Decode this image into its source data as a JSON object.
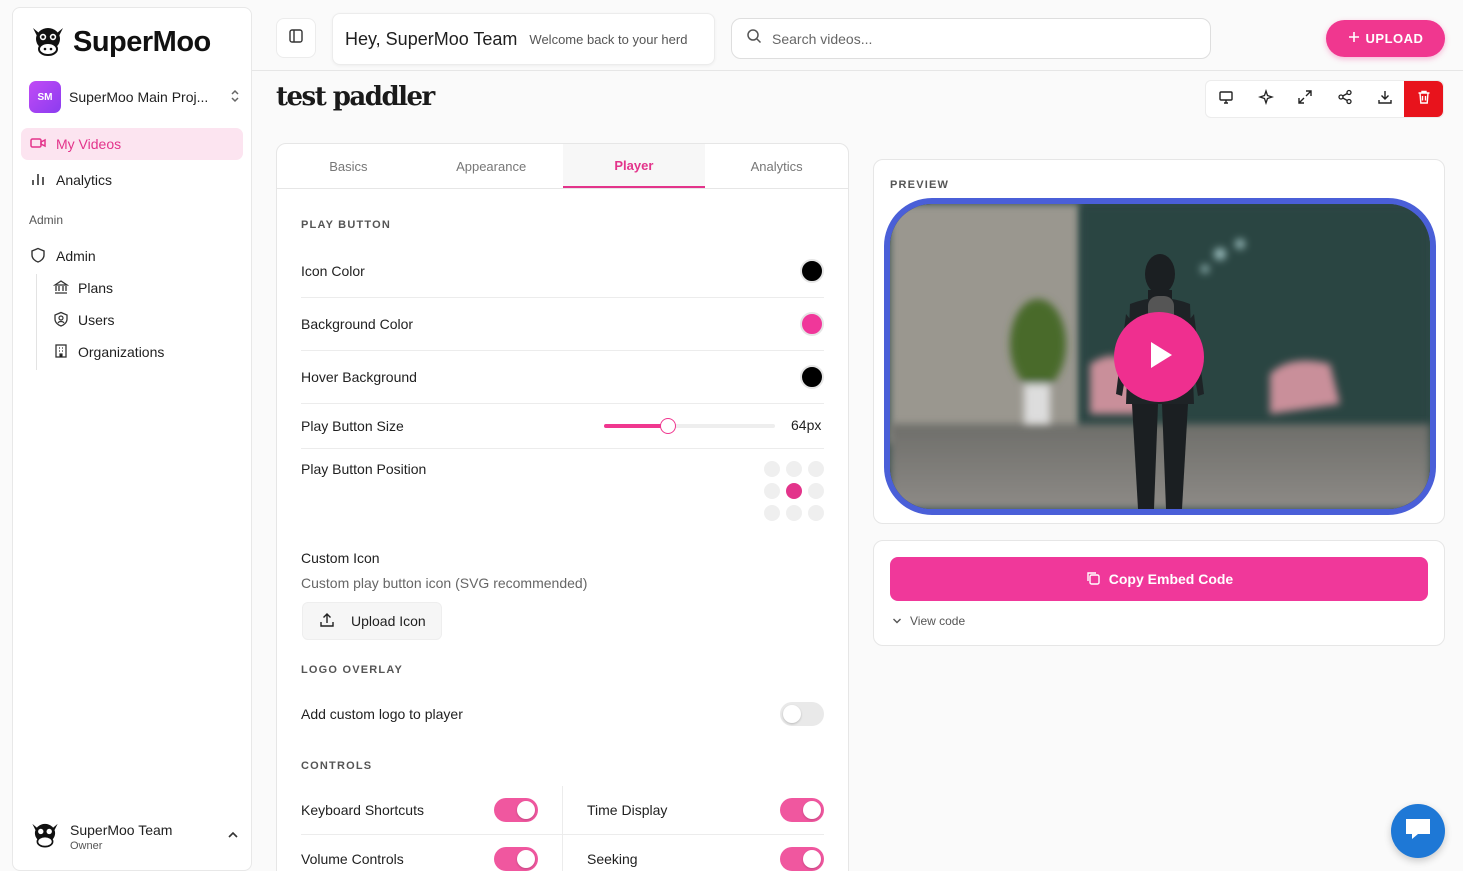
{
  "brand": {
    "name": "SuperMoo"
  },
  "project": {
    "initials": "SM",
    "name": "SuperMoo Main Proj..."
  },
  "nav": {
    "my_videos": "My Videos",
    "analytics": "Analytics",
    "admin_section": "Admin",
    "admin": "Admin",
    "plans": "Plans",
    "users": "Users",
    "organizations": "Organizations"
  },
  "user": {
    "name": "SuperMoo Team",
    "role": "Owner"
  },
  "header": {
    "greeting": "Hey, SuperMoo Team",
    "subtitle": "Welcome back to your herd",
    "search_placeholder": "Search videos...",
    "upload_label": "UPLOAD"
  },
  "page": {
    "title": "test paddler"
  },
  "toolbar": {
    "icons": [
      "monitor-icon",
      "sparkles-icon",
      "expand-icon",
      "share-icon",
      "download-icon",
      "trash-icon"
    ]
  },
  "tabs": [
    "Basics",
    "Appearance",
    "Player",
    "Analytics"
  ],
  "active_tab": "Player",
  "play_button": {
    "section_title": "PLAY BUTTON",
    "icon_color_label": "Icon Color",
    "icon_color": "#000000",
    "background_color_label": "Background Color",
    "background_color": "#f0379a",
    "hover_background_label": "Hover Background",
    "hover_background": "#000000",
    "size_label": "Play Button Size",
    "size_value": "64px",
    "size_fraction": 0.375,
    "position_label": "Play Button Position",
    "position_selected": "center",
    "custom_icon_label": "Custom Icon",
    "custom_icon_hint": "Custom play button icon (SVG recommended)",
    "upload_icon_label": "Upload Icon"
  },
  "logo_overlay": {
    "section_title": "LOGO OVERLAY",
    "add_logo_label": "Add custom logo to player",
    "add_logo_enabled": false
  },
  "controls": {
    "section_title": "CONTROLS",
    "keyboard_shortcuts": "Keyboard Shortcuts",
    "time_display": "Time Display",
    "volume_controls": "Volume Controls",
    "seeking": "Seeking",
    "keyboard_shortcuts_on": true,
    "time_display_on": true,
    "volume_controls_on": true,
    "seeking_on": true
  },
  "preview": {
    "label": "PREVIEW"
  },
  "embed": {
    "copy_label": "Copy Embed Code",
    "view_code_label": "View code"
  },
  "colors": {
    "accent": "#f0378f",
    "preview_border": "#4a5fd8",
    "danger": "#e8131c",
    "chat": "#1e78d6"
  }
}
